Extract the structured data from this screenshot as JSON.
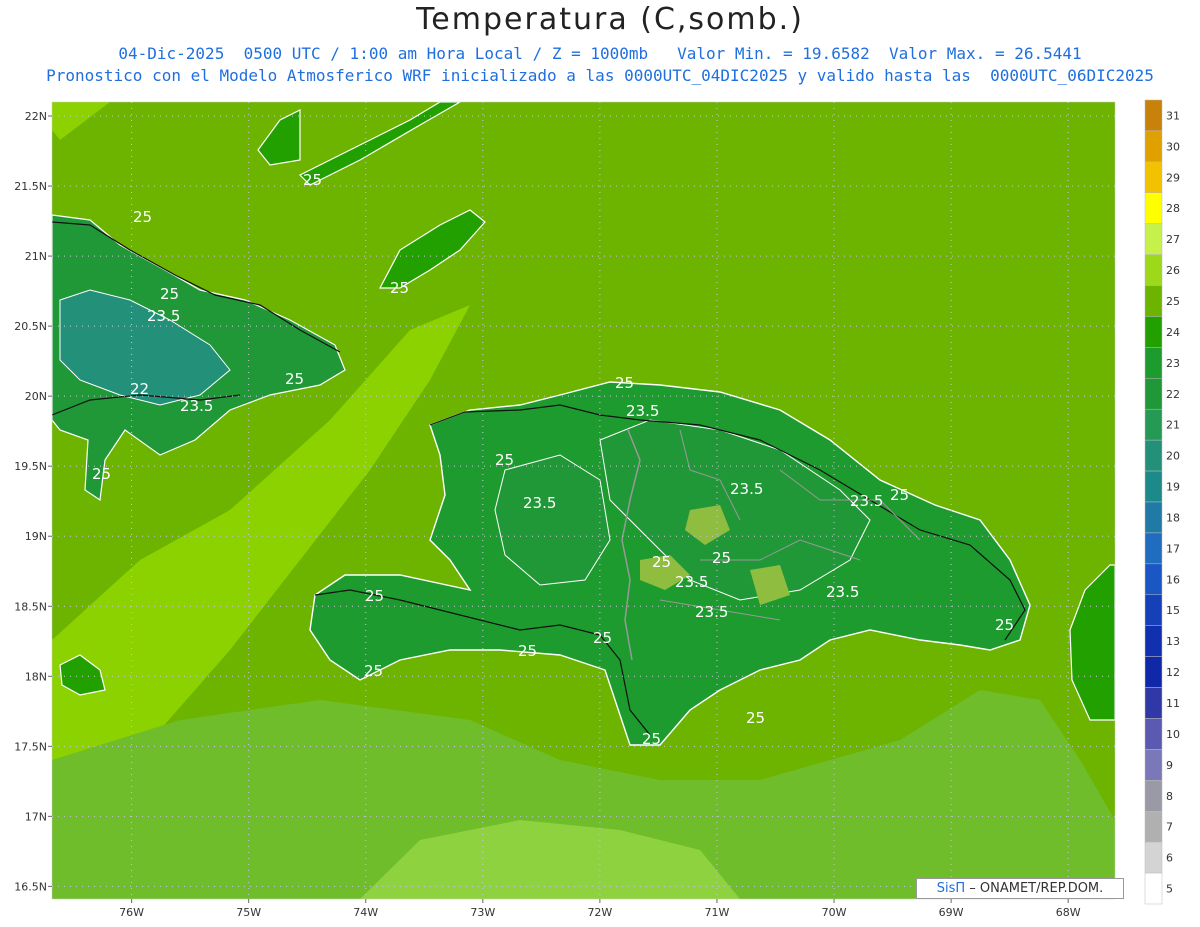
{
  "header": {
    "title": "Temperatura (C,somb.)",
    "subtitle_line1": "04-Dic-2025  0500 UTC / 1:00 am Hora Local / Z = 1000mb   Valor Min. = 19.6582  Valor Max. = 26.5441",
    "subtitle_line2": "Pronostico con el Modelo Atmosferico WRF inicializado a las 0000UTC_04DIC2025 y valido hasta las  0000UTC_06DIC2025"
  },
  "axes": {
    "lat_labels": [
      "22N",
      "21.5N",
      "21N",
      "20.5N",
      "20N",
      "19.5N",
      "19N",
      "18.5N",
      "18N",
      "17.5N",
      "17N",
      "16.5N"
    ],
    "lat_values": [
      22,
      21.5,
      21,
      20.5,
      20,
      19.5,
      19,
      18.5,
      18,
      17.5,
      17,
      16.5
    ],
    "lon_labels": [
      "76W",
      "75W",
      "74W",
      "73W",
      "72W",
      "71W",
      "70W",
      "69W",
      "68W"
    ],
    "lon_values": [
      -76,
      -75,
      -74,
      -73,
      -72,
      -71,
      -70,
      -69,
      -68
    ],
    "lat_range": [
      16.41,
      22.1
    ],
    "lon_range": [
      -76.68,
      -67.6
    ]
  },
  "colorbar": {
    "labels": [
      "31",
      "30",
      "29",
      "28",
      "27",
      "26",
      "25",
      "24",
      "23",
      "22",
      "21",
      "20",
      "19",
      "18",
      "17",
      "16",
      "15",
      "13",
      "12",
      "11",
      "10",
      "9",
      "8",
      "7",
      "6",
      "5"
    ],
    "colors": [
      "#c8820a",
      "#e0a000",
      "#f2c200",
      "#ffff00",
      "#c6f04a",
      "#9ed81a",
      "#6cb400",
      "#22a000",
      "#1e9b2e",
      "#219838",
      "#249a55",
      "#23917a",
      "#1d8a8a",
      "#1f7aa6",
      "#1f6cc0",
      "#1b57c4",
      "#1540b8",
      "#1030b0",
      "#1028a8",
      "#3038a8",
      "#5a5ab0",
      "#7a78b8",
      "#9a9aa6",
      "#b0b0b0",
      "#d4d4d4",
      "#ffffff"
    ]
  },
  "contours": {
    "labels": [
      "25",
      "25",
      "25",
      "23.5",
      "22",
      "23.5",
      "25",
      "25",
      "25",
      "25",
      "23.5",
      "25",
      "23.5",
      "23.5",
      "25",
      "23.5",
      "23.5",
      "23.5",
      "23.5",
      "25",
      "25",
      "25",
      "25",
      "25",
      "25",
      "25",
      "25",
      "25"
    ]
  },
  "credit": {
    "sis": "SisΠ",
    "text": "– ONAMET/REP.DOM."
  }
}
